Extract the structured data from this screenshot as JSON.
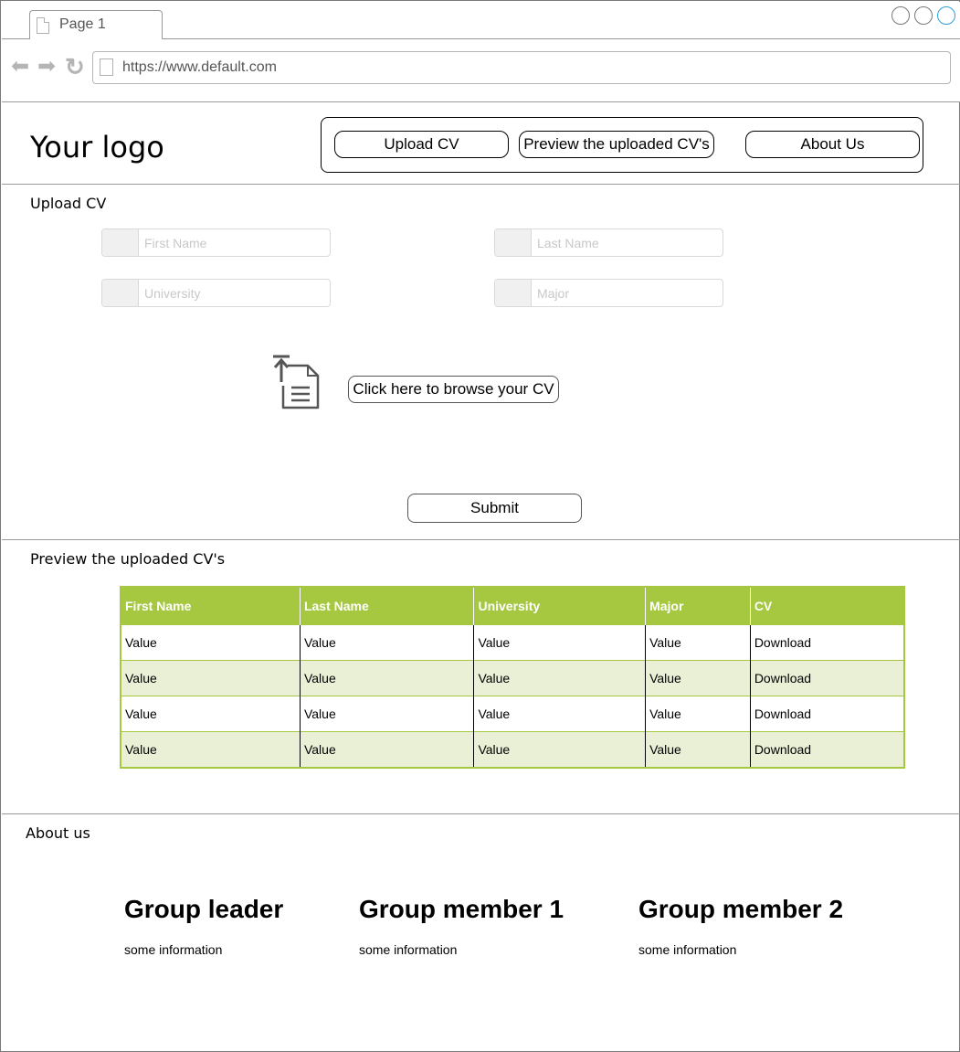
{
  "browser": {
    "tab_title": "Page 1",
    "url": "https://www.default.com"
  },
  "header": {
    "logo": "Your logo",
    "nav": {
      "upload": "Upload CV",
      "preview": "Preview the uploaded CV's",
      "about": "About Us"
    }
  },
  "upload": {
    "title": "Upload CV",
    "fields": {
      "first_name": "First Name",
      "last_name": "Last Name",
      "university": "University",
      "major": "Major"
    },
    "browse_label": "Click here to browse your CV",
    "submit_label": "Submit"
  },
  "preview": {
    "title": "Preview the uploaded CV's",
    "columns": [
      "First Name",
      "Last Name",
      "University",
      "Major",
      "CV"
    ],
    "rows": [
      [
        "Value",
        "Value",
        "Value",
        "Value",
        "Download"
      ],
      [
        "Value",
        "Value",
        "Value",
        "Value",
        "Download"
      ],
      [
        "Value",
        "Value",
        "Value",
        "Value",
        "Download"
      ],
      [
        "Value",
        "Value",
        "Value",
        "Value",
        "Download"
      ]
    ]
  },
  "about": {
    "title": "About us",
    "members": [
      {
        "name": "Group leader",
        "info": "some information"
      },
      {
        "name": "Group member 1",
        "info": "some information"
      },
      {
        "name": "Group member 2",
        "info": "some information"
      }
    ]
  },
  "colors": {
    "table_header": "#a6c840",
    "table_alt_row": "#e9f0d6",
    "window_accent": "#2a9fd8"
  }
}
